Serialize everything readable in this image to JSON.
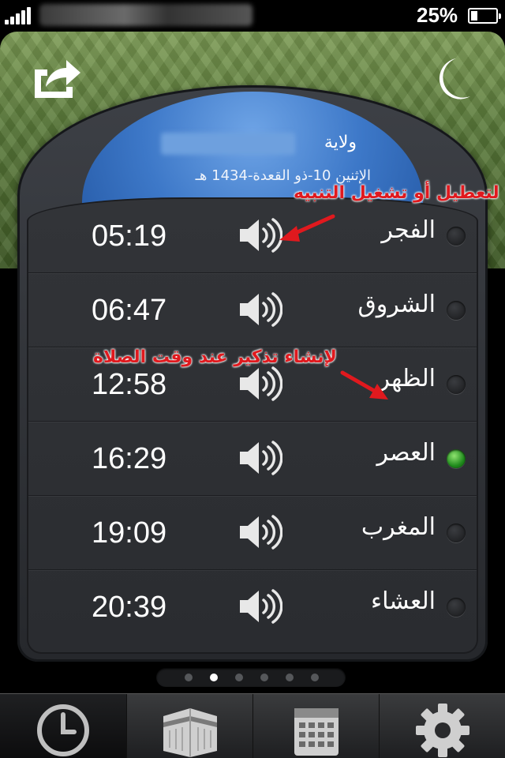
{
  "status_bar": {
    "battery_percent": "25%",
    "battery_level": 0.25
  },
  "header": {
    "share_icon": "share-icon",
    "night_icon": "crescent-moon-icon"
  },
  "location": {
    "label": "ولاية",
    "date": "الإثنين 10-ذو القعدة-1434 هـ"
  },
  "prayers": [
    {
      "name": "الفجر",
      "time": "05:19",
      "active": false
    },
    {
      "name": "الشروق",
      "time": "06:47",
      "active": false
    },
    {
      "name": "الظهر",
      "time": "12:58",
      "active": false
    },
    {
      "name": "العصر",
      "time": "16:29",
      "active": true
    },
    {
      "name": "المغرب",
      "time": "19:09",
      "active": false
    },
    {
      "name": "العشاء",
      "time": "20:39",
      "active": false
    }
  ],
  "annotations": {
    "toggle_alert": "لتعطيل أو تشغيل التنبيه",
    "create_reminder": "لإنشاء تذكير عند وقت الصلاة"
  },
  "pager": {
    "pages": 6,
    "current": 2
  },
  "tabbar": {
    "tabs": [
      {
        "icon": "clock-icon",
        "selected": true
      },
      {
        "icon": "kaaba-icon",
        "selected": false
      },
      {
        "icon": "calendar-icon",
        "selected": false
      },
      {
        "icon": "gear-icon",
        "selected": false
      }
    ]
  },
  "colors": {
    "active_dot": "#1f8a1c",
    "annotation": "#e0191e",
    "header_green": "#5a7a3a",
    "dome_blue": "#3d78c8"
  }
}
